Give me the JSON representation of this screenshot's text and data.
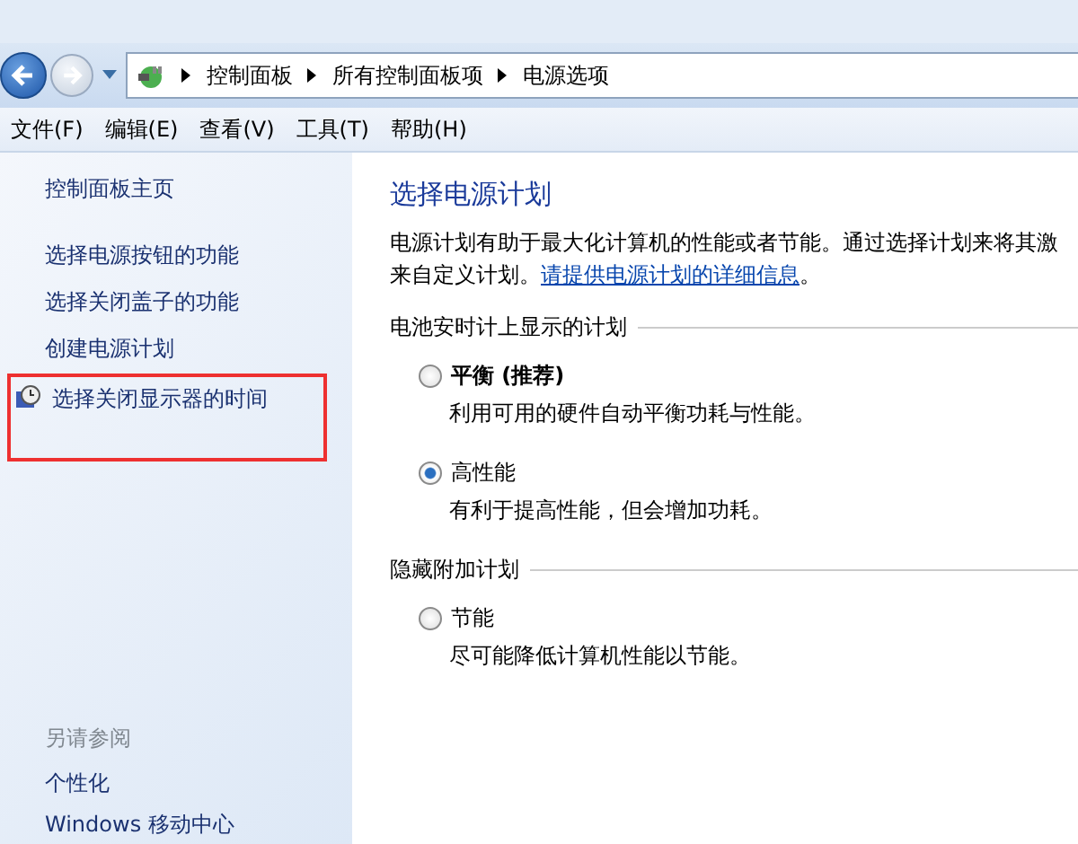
{
  "breadcrumb": [
    "控制面板",
    "所有控制面板项",
    "电源选项"
  ],
  "menu": [
    "文件(F)",
    "编辑(E)",
    "查看(V)",
    "工具(T)",
    "帮助(H)"
  ],
  "sidebar": {
    "home": "控制面板主页",
    "items": [
      {
        "label": "选择电源按钮的功能",
        "icon": false,
        "highlighted": false
      },
      {
        "label": "选择关闭盖子的功能",
        "icon": false,
        "highlighted": false
      },
      {
        "label": "创建电源计划",
        "icon": false,
        "highlighted": false
      },
      {
        "label": "选择关闭显示器的时间",
        "icon": true,
        "highlighted": true
      }
    ],
    "see_also": {
      "heading": "另请参阅",
      "items": [
        "个性化",
        "Windows 移动中心"
      ]
    }
  },
  "main": {
    "title": "选择电源计划",
    "description_line1": "电源计划有助于最大化计算机的性能或者节能。通过选择计划来将其激",
    "description_line2": "来自定义计划。",
    "link": "请提供电源计划的详细信息",
    "link_after": "。",
    "groups": [
      {
        "heading": "电池安时计上显示的计划",
        "plans": [
          {
            "name": "平衡 (推荐)",
            "bold": true,
            "selected": false,
            "description": "利用可用的硬件自动平衡功耗与性能。"
          },
          {
            "name": "高性能",
            "bold": false,
            "selected": true,
            "description": "有利于提高性能，但会增加功耗。"
          }
        ]
      },
      {
        "heading": "隐藏附加计划",
        "plans": [
          {
            "name": "节能",
            "bold": false,
            "selected": false,
            "description": "尽可能降低计算机性能以节能。"
          }
        ]
      }
    ]
  }
}
